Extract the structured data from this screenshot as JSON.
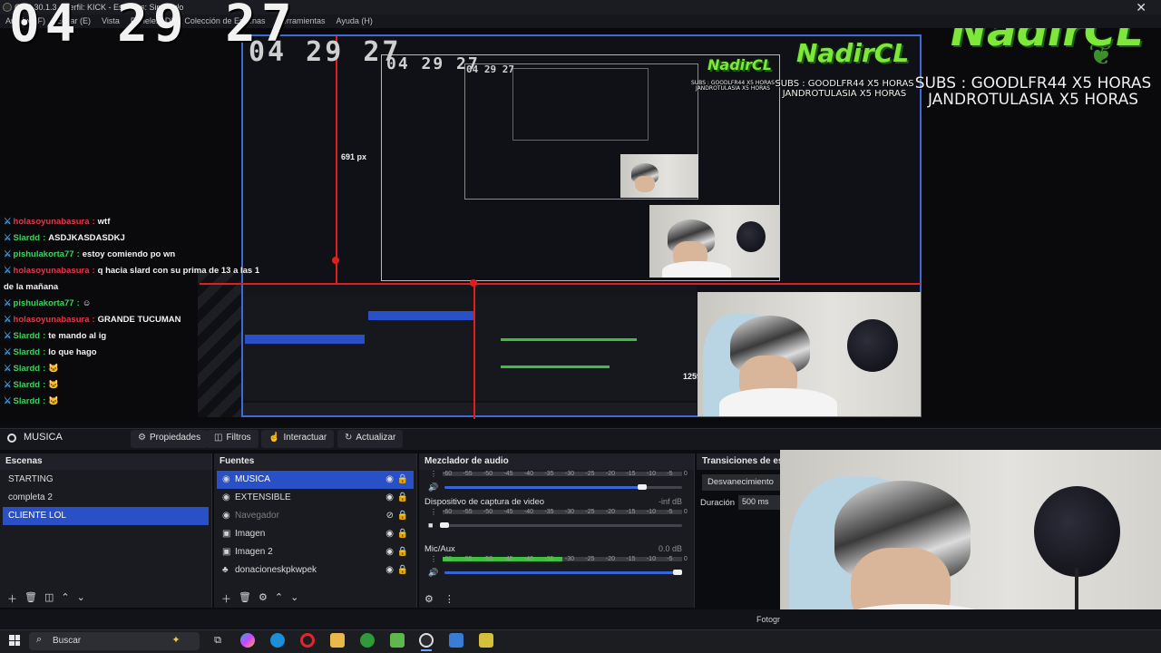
{
  "window": {
    "title": "OBS 30.1.3 - Perfil: KICK - Escenas: Sin Título",
    "menu": [
      "Archivo (F)",
      "Editar (E)",
      "Vista",
      "Paneles (D)",
      "Colección de Escenas",
      "Herramientas",
      "Ayuda (H)"
    ]
  },
  "overlay": {
    "clock": "04 29 27",
    "logo": "NadirCL",
    "subs_line1": "SUBS : GOODLFR44 X5 HORAS",
    "subs_line2": "JANDROTULASIA X5 HORAS",
    "measure_691": "691 px",
    "measure_1259": "1259 px"
  },
  "chat": [
    {
      "user": "holasoyunabasura",
      "color": "red",
      "msg": "wtf"
    },
    {
      "user": "Slardd",
      "color": "green",
      "msg": "ASDJKASDASDKJ"
    },
    {
      "user": "pishulakorta77",
      "color": "green",
      "msg": "estoy comiendo po wn"
    },
    {
      "user": "holasoyunabasura",
      "color": "red",
      "msg": "q hacia slard con su prima de 13 a las 1"
    },
    {
      "user": "",
      "color": "none",
      "msg": "de la mañana"
    },
    {
      "user": "pishulakorta77",
      "color": "green",
      "msg": "☺"
    },
    {
      "user": "holasoyunabasura",
      "color": "red",
      "msg": "GRANDE TUCUMAN"
    },
    {
      "user": "Slardd",
      "color": "green",
      "msg": "te mando al ig"
    },
    {
      "user": "Slardd",
      "color": "green",
      "msg": "lo que hago"
    },
    {
      "user": "Slardd",
      "color": "green",
      "msg": "🐱"
    },
    {
      "user": "Slardd",
      "color": "green",
      "msg": "🐱"
    },
    {
      "user": "Slardd",
      "color": "green",
      "msg": "🐱"
    }
  ],
  "toolbar": {
    "scene": "MUSICA",
    "propiedades": "Propiedades",
    "filtros": "Filtros",
    "interactuar": "Interactuar",
    "actualizar": "Actualizar"
  },
  "scenes": {
    "title": "Escenas",
    "items": [
      "STARTING",
      "completa 2",
      "CLIENTE LOL"
    ],
    "selected": 2
  },
  "sources": {
    "title": "Fuentes",
    "items": [
      "MUSICA",
      "EXTENSIBLE",
      "Navegador",
      "Imagen",
      "Imagen 2",
      "donacioneskpkwpek"
    ]
  },
  "mixer": {
    "title": "Mezclador de audio",
    "ticks": [
      "-60",
      "-55",
      "-50",
      "-45",
      "-40",
      "-35",
      "-30",
      "-25",
      "-20",
      "-15",
      "-10",
      "-5",
      "0"
    ],
    "channels": [
      {
        "name": "",
        "db": "",
        "level": 0.0,
        "volume": 0.85
      },
      {
        "name": "Dispositivo de captura de video",
        "db": "-inf dB",
        "level": 0.0,
        "volume": 0.02
      },
      {
        "name": "Mic/Aux",
        "db": "0.0 dB",
        "level": 0.5,
        "volume": 1.0
      }
    ]
  },
  "transitions": {
    "title": "Transiciones de escenas",
    "type": "Desvanecimiento",
    "duration_label": "Duración",
    "duration_value": "500 ms"
  },
  "stats": {
    "fotogramas": "Fotogr"
  },
  "taskbar": {
    "search": "Buscar"
  },
  "colors": {
    "accent": "#2a50c8",
    "red_line": "#e11d1d",
    "logo_green": "#7ee83a",
    "meter_green": "#3fbf3f"
  }
}
